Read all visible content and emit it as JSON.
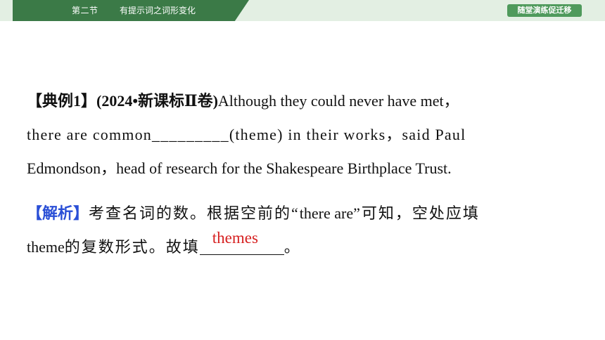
{
  "header": {
    "section": "第二节",
    "topic": "有提示词之词形变化",
    "practice_button": "随堂演练促迁移"
  },
  "example": {
    "label_open": "【典例1】",
    "source": "(2024•新课标Ⅱ卷)",
    "line1_text": "Although they could never have met，",
    "line2_pre": "there are common",
    "line2_blank": "_________",
    "line2_post": "(theme) in their works，said Paul",
    "line3_text": "Edmondson，head of research for the Shakespeare Birthplace Trust."
  },
  "analysis": {
    "label": "【解析】",
    "line1_a": "考查名词的数。根据空前的“",
    "line1_quote": "there are",
    "line1_b": "”可知，空处应填",
    "line2_pre": "theme",
    "line2_mid": "的复数形式。故填",
    "answer": "themes",
    "line2_end": "。"
  },
  "colors": {
    "header_green": "#3b7a47",
    "band_light_green": "#e3efe3",
    "button_green": "#4f9a5c",
    "analysis_label_blue": "#2a4fd6",
    "answer_red": "#d62020"
  }
}
